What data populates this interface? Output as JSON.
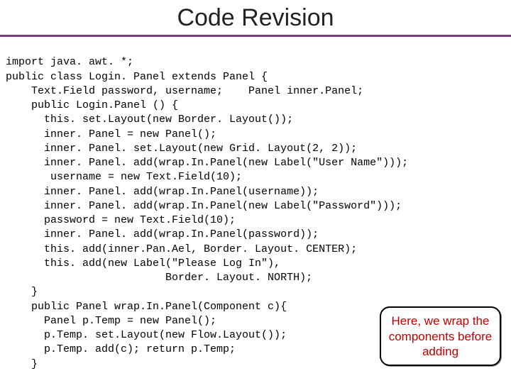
{
  "title": "Code Revision",
  "code_lines": [
    "import java. awt. *;",
    "public class Login. Panel extends Panel {",
    "    Text.Field password, username;    Panel inner.Panel;",
    "    public Login.Panel () {",
    "      this. set.Layout(new Border. Layout());",
    "      inner. Panel = new Panel();",
    "      inner. Panel. set.Layout(new Grid. Layout(2, 2));",
    "      inner. Panel. add(wrap.In.Panel(new Label(\"User Name\")));",
    "       username = new Text.Field(10);",
    "      inner. Panel. add(wrap.In.Panel(username));",
    "      inner. Panel. add(wrap.In.Panel(new Label(\"Password\")));",
    "      password = new Text.Field(10);",
    "      inner. Panel. add(wrap.In.Panel(password));",
    "      this. add(inner.Pan.Ael, Border. Layout. CENTER);",
    "      this. add(new Label(\"Please Log In\"),",
    "                         Border. Layout. NORTH);",
    "    }",
    "    public Panel wrap.In.Panel(Component c){",
    "      Panel p.Temp = new Panel();",
    "      p.Temp. set.Layout(new Flow.Layout());",
    "      p.Temp. add(c); return p.Temp;",
    "    }"
  ],
  "callout": "Here, we wrap the components before adding"
}
